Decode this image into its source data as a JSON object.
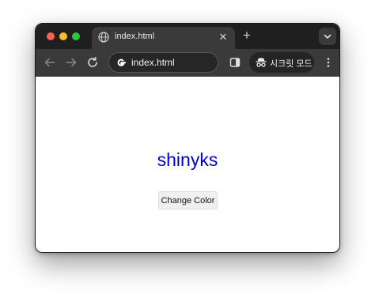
{
  "browser": {
    "tab": {
      "title": "index.html",
      "close_glyph": "✕"
    },
    "new_tab_glyph": "+",
    "toolbar": {
      "address": "index.html",
      "incognito_label": "시크릿 모드"
    },
    "icons": {
      "tab": "globe-icon",
      "close": "close-icon",
      "new_tab": "plus-icon",
      "tab_search": "chevron-down-icon",
      "back": "back-arrow-icon",
      "forward": "forward-arrow-icon",
      "reload": "reload-icon",
      "omnibox": "google-g-icon",
      "side_panel": "side-panel-icon",
      "incognito": "incognito-icon",
      "menu": "kebab-menu-icon"
    },
    "colors": {
      "tabstrip": "#1f1f1f",
      "toolbar": "#3a3a3a",
      "traffic_red": "#ff5f57",
      "traffic_yellow": "#febc2e",
      "traffic_green": "#28c840"
    }
  },
  "page": {
    "heading": "shinyks",
    "heading_color": "#0000cc",
    "button_label": "Change Color"
  }
}
